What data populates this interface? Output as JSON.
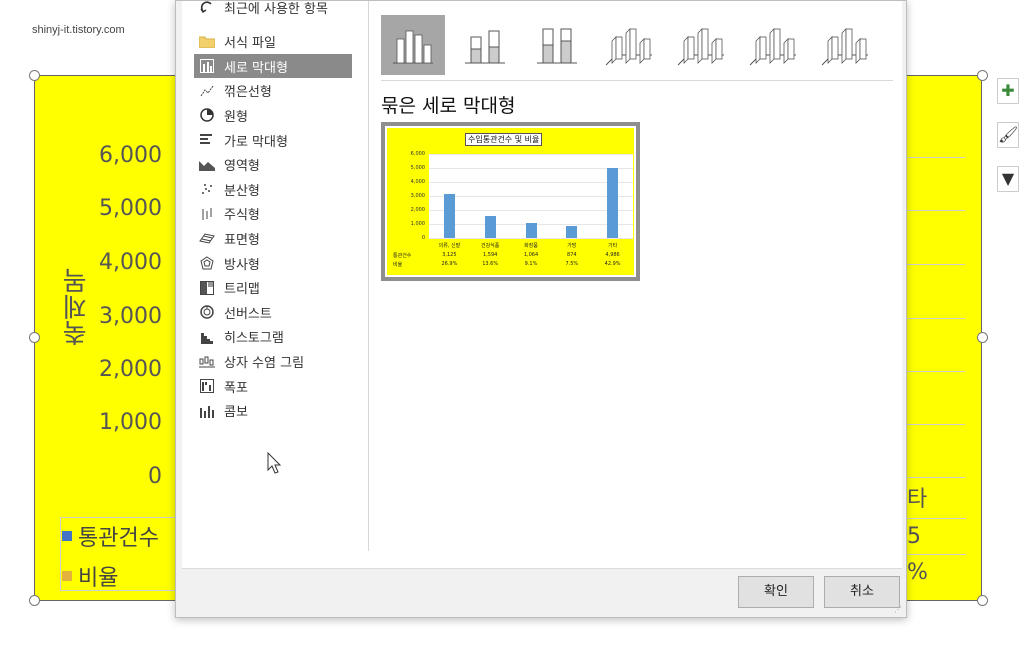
{
  "watermark": "shinyj-it.tistory.com",
  "background_chart": {
    "y_axis_label": "축제목",
    "y_ticks": [
      "6,000",
      "5,000",
      "4,000",
      "3,000",
      "2,000",
      "1,000",
      "0"
    ],
    "rows": [
      {
        "label": "통관건수",
        "color": "#4472c4",
        "partial_value": "5"
      },
      {
        "label": "비율",
        "color": "#e3b23c",
        "partial_value": "%"
      }
    ],
    "partial_header": "타"
  },
  "chart_types": [
    {
      "label": "최근에 사용한 항목",
      "icon": "recent-icon"
    },
    {
      "label": "서식 파일",
      "icon": "folder-icon"
    },
    {
      "label": "세로 막대형",
      "icon": "column-chart-icon",
      "selected": true
    },
    {
      "label": "꺾은선형",
      "icon": "line-chart-icon"
    },
    {
      "label": "원형",
      "icon": "pie-chart-icon"
    },
    {
      "label": "가로 막대형",
      "icon": "bar-chart-icon"
    },
    {
      "label": "영역형",
      "icon": "area-chart-icon"
    },
    {
      "label": "분산형",
      "icon": "scatter-chart-icon"
    },
    {
      "label": "주식형",
      "icon": "stock-chart-icon"
    },
    {
      "label": "표면형",
      "icon": "surface-chart-icon"
    },
    {
      "label": "방사형",
      "icon": "radar-chart-icon"
    },
    {
      "label": "트리맵",
      "icon": "treemap-chart-icon"
    },
    {
      "label": "선버스트",
      "icon": "sunburst-chart-icon"
    },
    {
      "label": "히스토그램",
      "icon": "histogram-chart-icon"
    },
    {
      "label": "상자 수염 그림",
      "icon": "boxwhisker-chart-icon"
    },
    {
      "label": "폭포",
      "icon": "waterfall-chart-icon"
    },
    {
      "label": "콤보",
      "icon": "combo-chart-icon"
    }
  ],
  "subtypes": [
    {
      "icon": "clustered-column-icon",
      "selected": true
    },
    {
      "icon": "stacked-column-icon"
    },
    {
      "icon": "100-stacked-column-icon"
    },
    {
      "icon": "3d-clustered-column-icon"
    },
    {
      "icon": "3d-stacked-column-icon"
    },
    {
      "icon": "3d-100-stacked-column-icon"
    },
    {
      "icon": "3d-column-icon"
    }
  ],
  "section_title": "묶은 세로 막대형",
  "chart_data": {
    "type": "bar",
    "title": "수입통관건수 및 비율",
    "ylabel": "",
    "ylim": [
      0,
      6000
    ],
    "yticks": [
      "6,000",
      "5,000",
      "4,000",
      "3,000",
      "2,000",
      "1,000",
      "0"
    ],
    "categories": [
      "의류, 신발",
      "건강식품",
      "화장품",
      "가방",
      "기타"
    ],
    "series": [
      {
        "name": "통관건수",
        "values": [
          3125,
          1594,
          1064,
          874,
          4986
        ],
        "labels": [
          "3,125",
          "1,594",
          "1,064",
          "874",
          "4,986"
        ]
      },
      {
        "name": "비율",
        "labels": [
          "26.9%",
          "13.6%",
          "9.1%",
          "7.5%",
          "42.9%"
        ]
      }
    ],
    "colors": {
      "bar": "#5b9bd5",
      "background": "#ffff00"
    }
  },
  "buttons": {
    "ok": "확인",
    "cancel": "취소"
  }
}
